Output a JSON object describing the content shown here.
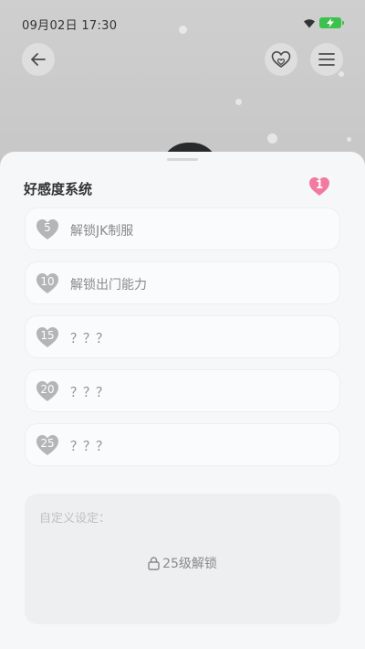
{
  "status_bar": {
    "time": "09月02日  17:30",
    "wifi_icon": "wifi-icon",
    "battery_icon": "battery-charging-icon",
    "battery_color": "#3bc24c"
  },
  "top_bar": {
    "back_icon": "back-arrow-icon",
    "favorite_icon": "heart-outline-icon",
    "menu_icon": "menu-icon"
  },
  "affinity": {
    "title": "好感度系统",
    "current_level": "1",
    "accent_color": "#f27aa0",
    "locked_color": "#b5b5b5",
    "items": [
      {
        "level": "5",
        "label": "解锁JK制服"
      },
      {
        "level": "10",
        "label": "解锁出门能力"
      },
      {
        "level": "15",
        "label": "？？？"
      },
      {
        "level": "20",
        "label": "？？？"
      },
      {
        "level": "25",
        "label": "？？？"
      }
    ]
  },
  "custom": {
    "label": "自定义设定：",
    "lock_icon": "lock-icon",
    "lock_text": "25级解锁"
  }
}
